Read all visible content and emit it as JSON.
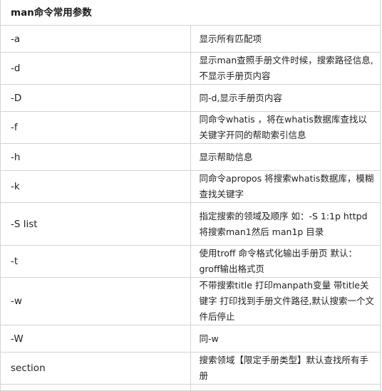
{
  "table": {
    "title": "man命令常用参数",
    "rows": [
      {
        "param": "-a",
        "desc": "显示所有匹配项"
      },
      {
        "param": "-d",
        "desc": "显示man查照手册文件时候，搜索路径信息,不显示手册页内容"
      },
      {
        "param": "-D",
        "desc": "同-d,显示手册页内容"
      },
      {
        "param": "-f",
        "desc": "同命令whatis ，将在whatis数据库查找以关键字开同的帮助索引信息"
      },
      {
        "param": "-h",
        "desc": "显示帮助信息"
      },
      {
        "param": "-k",
        "desc": "同命令apropos 将搜索whatis数据库，模糊查找关键字"
      },
      {
        "param": "-S list",
        "desc": "指定搜索的领域及顺序 如：-S 1:1p httpd 将搜索man1然后 man1p 目录"
      },
      {
        "param": "-t",
        "desc": "使用troff 命令格式化输出手册页 默认：groff输出格式页"
      },
      {
        "param": "-w",
        "desc": "不带搜索title 打印manpath变量 带title关键字 打印找到手册文件路径,默认搜索一个文件后停止"
      },
      {
        "param": "-W",
        "desc": "同-w"
      },
      {
        "param": "section",
        "desc": "搜索领域【限定手册类型】默认查找所有手册"
      }
    ]
  }
}
